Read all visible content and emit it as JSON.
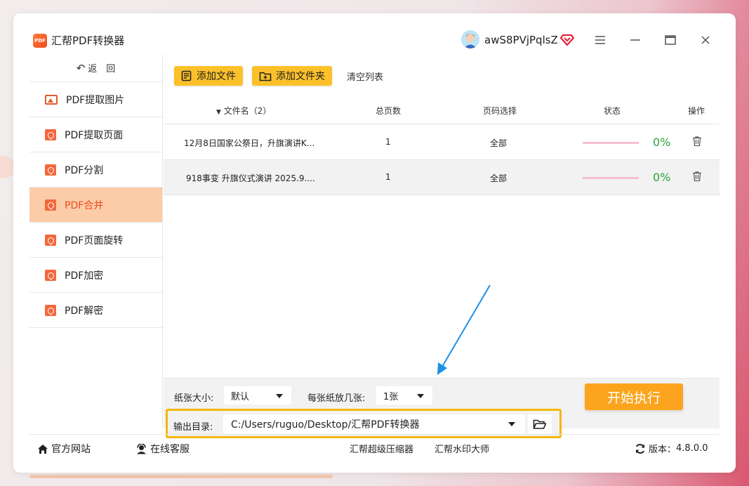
{
  "app": {
    "title": "汇帮PDF转换器",
    "logo_text": "PDF"
  },
  "user": {
    "name": "awS8PVjPqlsZ"
  },
  "window_controls": {
    "menu": "≡",
    "minimize": "─",
    "maximize": "□",
    "close": "✕"
  },
  "sidebar": {
    "back_label": "返　回",
    "items": [
      {
        "label": "PDF提取图片",
        "icon": "image-icon"
      },
      {
        "label": "PDF提取页面",
        "icon": "pdf-icon"
      },
      {
        "label": "PDF分割",
        "icon": "pdf-icon"
      },
      {
        "label": "PDF合并",
        "icon": "pdf-icon",
        "active": true
      },
      {
        "label": "PDF页面旋转",
        "icon": "pdf-icon"
      },
      {
        "label": "PDF加密",
        "icon": "pdf-icon"
      },
      {
        "label": "PDF解密",
        "icon": "pdf-icon"
      }
    ]
  },
  "toolbar": {
    "add_file": "添加文件",
    "add_folder": "添加文件夹",
    "clear_list": "清空列表"
  },
  "table": {
    "headers": {
      "filename": "文件名（2）",
      "pages": "总页数",
      "page_select": "页码选择",
      "status": "状态",
      "action": "操作"
    },
    "rows": [
      {
        "filename": "12月8日国家公祭日，升旗演讲K...",
        "pages": "1",
        "page_select": "全部",
        "progress": "0%"
      },
      {
        "filename": "918事变 升旗仪式演讲 2025.9....",
        "pages": "1",
        "page_select": "全部",
        "progress": "0%"
      }
    ]
  },
  "options": {
    "paper_size_label": "纸张大小:",
    "paper_size_value": "默认",
    "per_sheet_label": "每张纸放几张:",
    "per_sheet_value": "1张"
  },
  "output": {
    "label": "输出目录:",
    "path": "C:/Users/ruguo/Desktop/汇帮PDF转换器"
  },
  "start_button": "开始执行",
  "statusbar": {
    "website": "官方网站",
    "support": "在线客服",
    "link1": "汇帮超级压缩器",
    "link2": "汇帮水印大师",
    "version_label": "版本：",
    "version": "4.8.0.0"
  },
  "colors": {
    "accent": "#f04b1f",
    "active_bg": "#fccca8",
    "button_yellow": "#fcc12a",
    "start_orange": "#fca41e",
    "progress_green": "#2aa33a",
    "highlight_border": "#f6b60a",
    "annotation_arrow": "#1e90e6"
  }
}
